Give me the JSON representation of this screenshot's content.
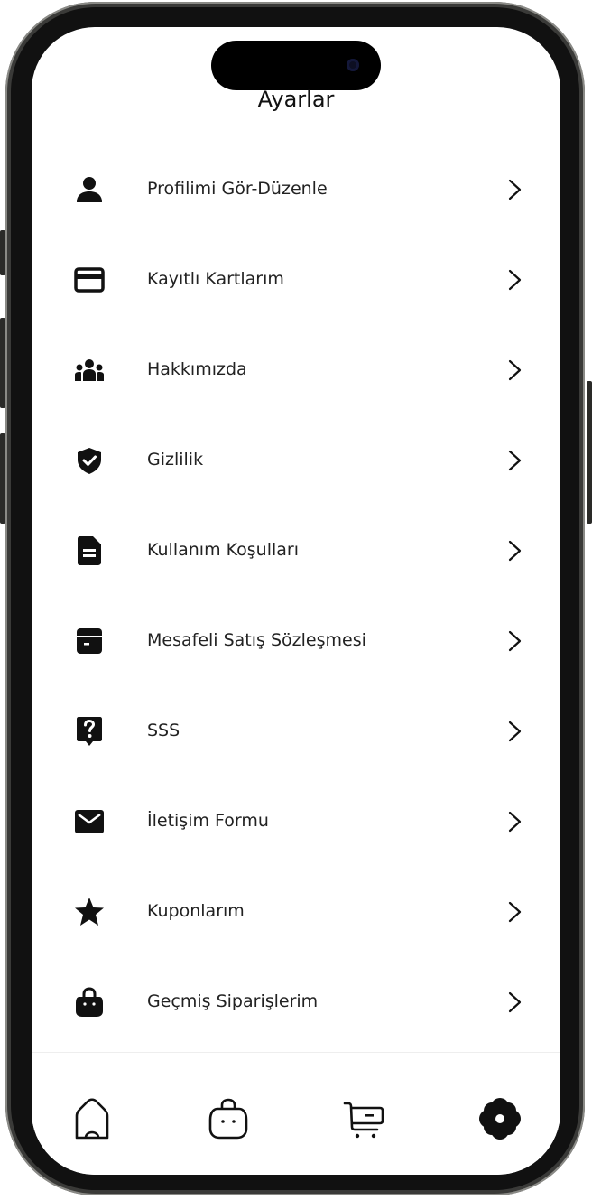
{
  "header": {
    "title": "Ayarlar"
  },
  "menu": [
    {
      "label": "Profilimi Gör-Düzenle",
      "icon": "person-icon"
    },
    {
      "label": "Kayıtlı Kartlarım",
      "icon": "credit-card-icon"
    },
    {
      "label": "Hakkımızda",
      "icon": "group-icon"
    },
    {
      "label": "Gizlilik",
      "icon": "shield-check-icon"
    },
    {
      "label": "Kullanım Koşulları",
      "icon": "document-icon"
    },
    {
      "label": "Mesafeli Satış Sözleşmesi",
      "icon": "archive-box-icon"
    },
    {
      "label": "SSS",
      "icon": "question-icon"
    },
    {
      "label": "İletişim Formu",
      "icon": "mail-icon"
    },
    {
      "label": "Kuponlarım",
      "icon": "star-icon"
    },
    {
      "label": "Geçmiş Siparişlerim",
      "icon": "shopping-bag-icon"
    }
  ],
  "tabbar": [
    {
      "icon": "home-icon"
    },
    {
      "icon": "bag-face-icon"
    },
    {
      "icon": "cart-icon"
    },
    {
      "icon": "flower-settings-icon",
      "active": true
    }
  ],
  "colors": {
    "icon": "#111111",
    "text": "#222222",
    "background": "#ffffff"
  }
}
